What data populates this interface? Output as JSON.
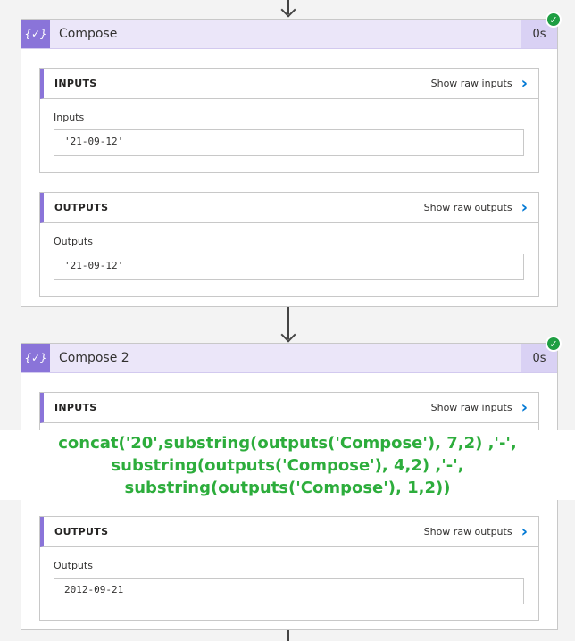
{
  "compose1": {
    "title": "Compose",
    "duration": "0s",
    "icon": "{✓}",
    "inputs": {
      "header": "INPUTS",
      "raw_link": "Show raw inputs",
      "field_label": "Inputs",
      "field_value": "'21-09-12'"
    },
    "outputs": {
      "header": "OUTPUTS",
      "raw_link": "Show raw outputs",
      "field_label": "Outputs",
      "field_value": "'21-09-12'"
    }
  },
  "compose2": {
    "title": "Compose 2",
    "duration": "0s",
    "icon": "{✓}",
    "inputs": {
      "header": "INPUTS",
      "raw_link": "Show raw inputs"
    },
    "outputs": {
      "header": "OUTPUTS",
      "raw_link": "Show raw outputs",
      "field_label": "Outputs",
      "field_value": "2012-09-21"
    }
  },
  "expression_overlay": {
    "line1": "concat('20',substring(outputs('Compose'),  7,2) ,'-',",
    "line2": "substring(outputs('Compose'), 4,2) ,'-',",
    "line3": "substring(outputs('Compose'), 1,2))"
  },
  "colors": {
    "accent": "#8a74d9",
    "header_bg": "#ebe6f9",
    "success": "#1e9e42",
    "expression_text": "#2dad3c",
    "link_chevron": "#0078d4"
  }
}
